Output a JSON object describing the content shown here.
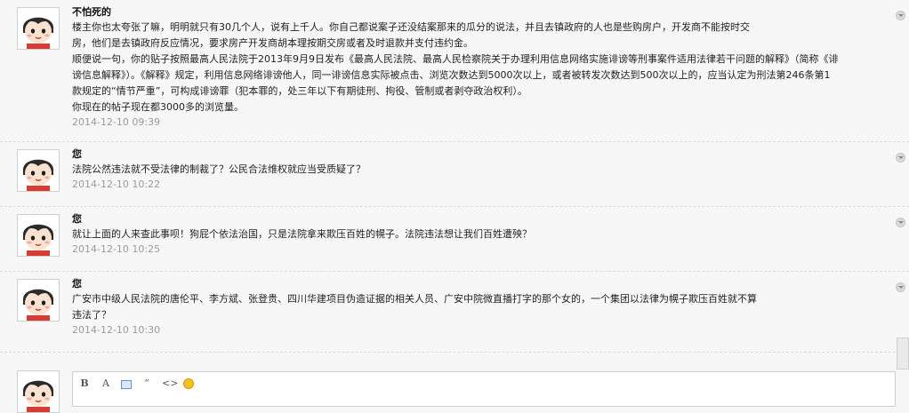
{
  "comments": [
    {
      "author": "不怕死的",
      "lines": [
        "楼主你也太夸张了嘛，明明就只有30几个人，说有上千人。你自己都说案子还没结案那来的瓜分的说法，并且去镇政府的人也是些购房户，开发商不能按时交",
        "房，他们是去镇政府反应情况，要求房产开发商胡本理按期交房或者及时退款并支付违约金。",
        "顺便说一句，你的贴子按照最高人民法院于2013年9月9日发布《最高人民法院、最高人民检察院关于办理利用信息网络实施诽谤等刑事案件适用法律若干问题的解释》（简称《诽",
        "谤信息解释》）。《解释》规定，利用信息网络诽谤他人，同一诽谤信息实际被点击、浏览次数达到5000次以上，或者被转发次数达到500次以上的，应当认定为刑法第246条第1",
        "款规定的“情节严重”，可构成诽谤罪（犯本罪的，处三年以下有期徒刑、拘役、管制或者剥夺政治权利）。",
        "你现在的帖子现在都3000多的浏览量。"
      ],
      "time": "2014-12-10 09:39"
    },
    {
      "author": "您",
      "lines": [
        "法院公然违法就不受法律的制裁了？公民合法维权就应当受质疑了？"
      ],
      "time": "2014-12-10 10:22"
    },
    {
      "author": "您",
      "lines": [
        "就让上面的人来查此事呗！狗屁个依法治国，只是法院拿来欺压百姓的幌子。法院违法想让我们百姓遭殃？"
      ],
      "time": "2014-12-10 10:25"
    },
    {
      "author": "您",
      "lines": [
        "广安市中级人民法院的唐伦平、李方斌、张登贵、四川华建项目伪造证据的相关人员、广安中院微直播打字的那个女的，一个集团以法律为幌子欺压百姓就不算",
        "违法了？"
      ],
      "time": "2014-12-10 10:30"
    }
  ],
  "editor": {
    "toolbar": {
      "bold_label": "B",
      "font_label": "A",
      "quote_label": "“",
      "code_label": "<>"
    }
  }
}
